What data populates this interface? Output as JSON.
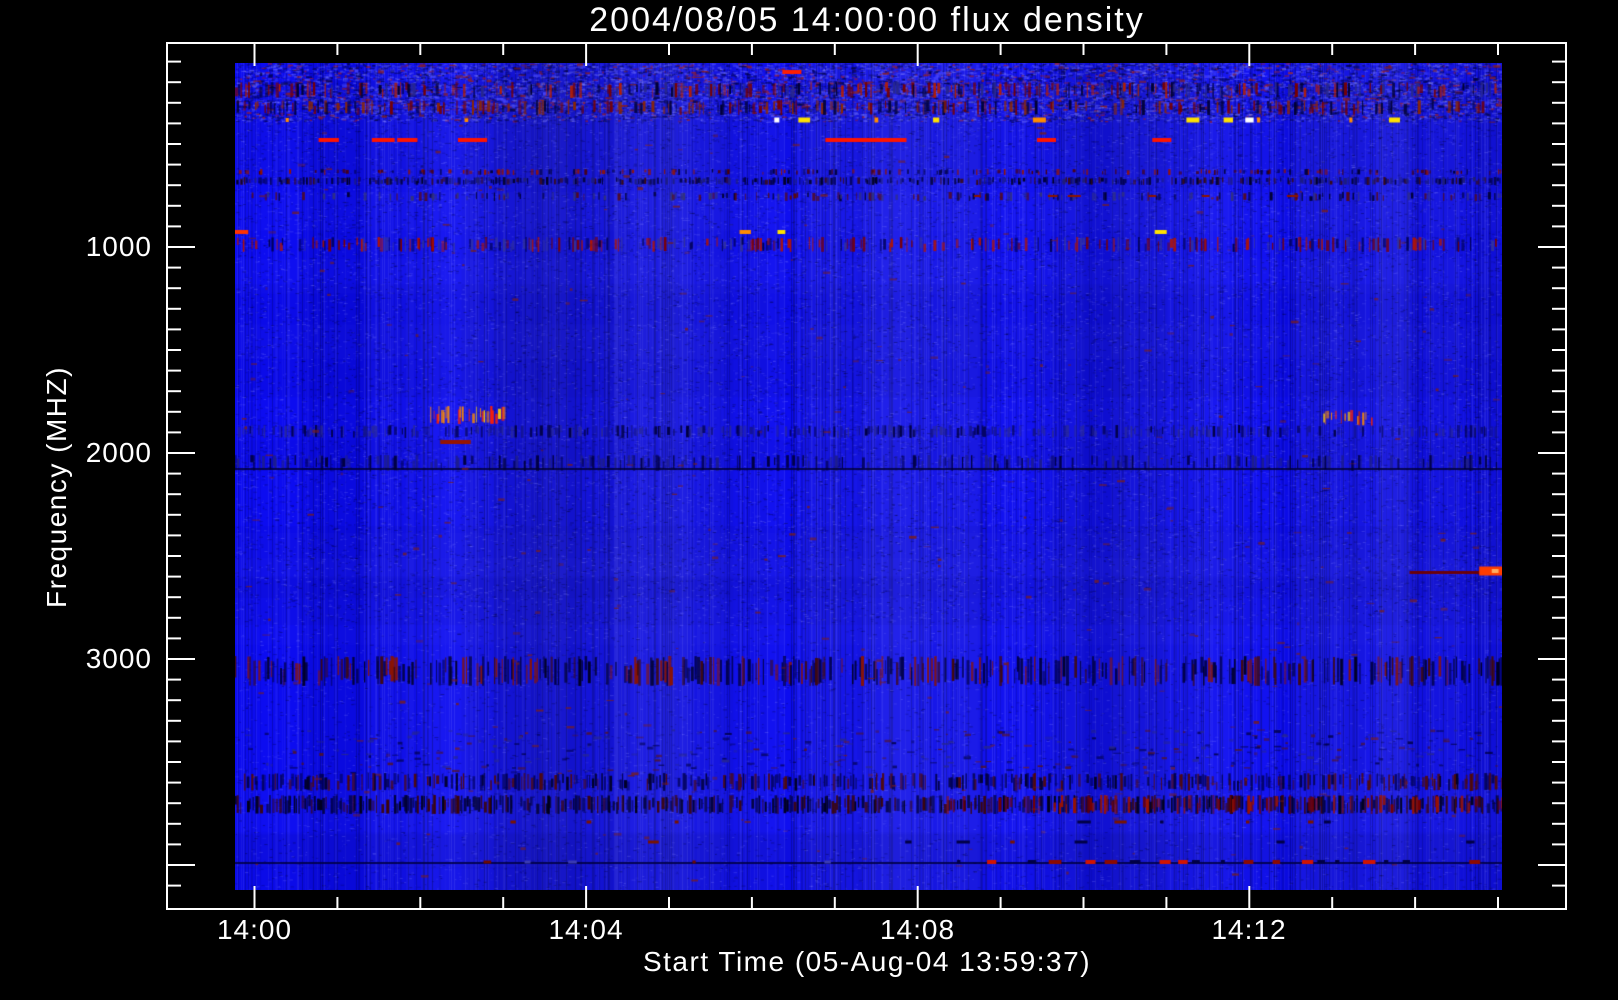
{
  "chart": {
    "background_color": "#000000",
    "frame_color": "#ffffff",
    "text_color": "#ffffff"
  },
  "chart_data": {
    "type": "heatmap",
    "title": "2004/08/05 14:00:00 flux density",
    "xlabel": "Start Time (05-Aug-04 13:59:37)",
    "ylabel": "Frequency (MHZ)",
    "x_ticks": [
      "14:00",
      "14:04",
      "14:08",
      "14:12"
    ],
    "x_minor_ticks_per_interval": 4,
    "y_tick_values": [
      1000,
      2000,
      3000
    ],
    "y_minor_step_mhz": 100,
    "freq_range_mhz": [
      100,
      4100
    ],
    "time_start": "13:59:37",
    "duration_minutes": 15.3,
    "legend_position": "none",
    "grid": false,
    "colormap": "saturated blue background; red/orange/yellow/white = strong flux (RFI), near-black = low",
    "base_color": "#0c0cf0",
    "features": [
      {
        "kind": "texture",
        "name": "top-noise-zone",
        "f0": 105,
        "f1": 330,
        "density": 1.3,
        "colors": [
          "#000046",
          "#4646ff",
          "#8c1e1e"
        ]
      },
      {
        "kind": "vticks",
        "name": "speckle-band-240mhz",
        "f0": 200,
        "f1": 275,
        "x0": 0,
        "x1": 1,
        "density": 0.55,
        "colors": [
          "#780000",
          "#000032",
          "#b41e00",
          "#28288c"
        ]
      },
      {
        "kind": "vticks",
        "name": "speckle-band-320mhz",
        "f0": 285,
        "f1": 360,
        "x0": 0,
        "x1": 1,
        "density": 0.4,
        "colors": [
          "#780000",
          "#000032",
          "#8c2800"
        ]
      },
      {
        "kind": "segments",
        "name": "red-dash-150mhz",
        "f": 150,
        "h": 4,
        "list": [
          [
            0.432,
            0.447,
            "#ff1e00"
          ]
        ]
      },
      {
        "kind": "dashrow",
        "name": "rfi-row-380mhz",
        "f": 383,
        "x0": 0.385,
        "x1": 1.0,
        "density": 0.3,
        "h": 5,
        "colors": [
          "#ff2000",
          "#ff8c00",
          "#ffffff",
          "#ffe100",
          "#b42000"
        ]
      },
      {
        "kind": "dashrow",
        "name": "rfi-row-380mhz-left",
        "f": 383,
        "x0": 0.04,
        "x1": 0.3,
        "density": 0.1,
        "h": 4,
        "colors": [
          "#b42000",
          "#ff8c00"
        ]
      },
      {
        "kind": "segments",
        "name": "red-lines-480mhz",
        "f": 480,
        "h": 4,
        "list": [
          [
            0.066,
            0.082,
            "#ff1400"
          ],
          [
            0.108,
            0.126,
            "#ff1400"
          ],
          [
            0.128,
            0.144,
            "#ff1400"
          ],
          [
            0.176,
            0.199,
            "#ff1400"
          ],
          [
            0.466,
            0.53,
            "#ff1400"
          ],
          [
            0.633,
            0.648,
            "#ff1400"
          ],
          [
            0.724,
            0.739,
            "#ff1400"
          ]
        ]
      },
      {
        "kind": "vticks",
        "name": "speckle-band-640mhz",
        "f0": 620,
        "f1": 652,
        "x0": 0,
        "x1": 1,
        "density": 0.35,
        "colors": [
          "#961400",
          "#500000",
          "#000032"
        ]
      },
      {
        "kind": "vticks",
        "name": "dark-band-680mhz",
        "f0": 660,
        "f1": 700,
        "x0": 0,
        "x1": 1,
        "density": 0.75,
        "colors": [
          "#000020",
          "#000046",
          "#1e1e78",
          "#3c0a0a"
        ]
      },
      {
        "kind": "vticks",
        "name": "dark-band-755mhz",
        "f0": 735,
        "f1": 775,
        "x0": 0,
        "x1": 1,
        "density": 0.35,
        "colors": [
          "#000032",
          "#32327d",
          "#5a0a0a"
        ]
      },
      {
        "kind": "dashrow",
        "name": "dim-red-row-750mhz",
        "f": 752,
        "x0": 0.45,
        "x1": 1.0,
        "density": 0.18,
        "h": 2,
        "colors": [
          "#8c1400"
        ]
      },
      {
        "kind": "dashrow",
        "name": "dot-row-925mhz",
        "f": 925,
        "x0": 0,
        "x1": 1,
        "density": 0.12,
        "h": 4,
        "colors": [
          "#ffffff",
          "#ff8c00",
          "#ff3200",
          "#ffe100"
        ]
      },
      {
        "kind": "vticks",
        "name": "rfi-band-950-1025mhz",
        "f0": 950,
        "f1": 1025,
        "x0": 0,
        "x1": 1,
        "density": 0.5,
        "colors": [
          "#7d0000",
          "#b41400",
          "#000050",
          "#32329b"
        ]
      },
      {
        "kind": "vticks",
        "name": "color-cluster-1800-left",
        "f0": 1770,
        "f1": 1860,
        "x0": 0.154,
        "x1": 0.212,
        "density": 0.8,
        "colors": [
          "#ffd200",
          "#ff8c00",
          "#ff2000"
        ]
      },
      {
        "kind": "vticks",
        "name": "color-cluster-1800-right",
        "f0": 1790,
        "f1": 1870,
        "x0": 0.859,
        "x1": 0.897,
        "density": 0.8,
        "colors": [
          "#ffd200",
          "#ff8c00",
          "#ff2000",
          "#c81e00"
        ]
      },
      {
        "kind": "segments",
        "name": "dim-red-1950mhz",
        "f": 1947,
        "h": 4,
        "list": [
          [
            0.162,
            0.186,
            "#961400"
          ]
        ]
      },
      {
        "kind": "vticks",
        "name": "dark-striped-1890mhz",
        "f0": 1864,
        "f1": 1925,
        "x0": 0,
        "x1": 1,
        "density": 0.6,
        "colors": [
          "#000041",
          "#14148c",
          "#28289b"
        ]
      },
      {
        "kind": "vticks",
        "name": "dark-striped-2050mhz",
        "f0": 2010,
        "f1": 2085,
        "x0": 0,
        "x1": 1,
        "density": 0.5,
        "colors": [
          "#000041",
          "#1e1e8c"
        ]
      },
      {
        "kind": "hline",
        "name": "dark-line-2075mhz",
        "f": 2075,
        "h": 2,
        "color": "#000032",
        "alpha": 0.8,
        "x0": 0,
        "x1": 1
      },
      {
        "kind": "hline",
        "name": "red-line-2570mhz",
        "f": 2572,
        "h": 3,
        "color": "#700000",
        "alpha": 0.95,
        "x0": 0.927,
        "x1": 0.99
      },
      {
        "kind": "blob",
        "name": "bright-blob-2570mhz",
        "f": 2572,
        "x0": 0.982,
        "x1": 1.0,
        "h": 9,
        "color": "#ff3c00"
      },
      {
        "kind": "vticks",
        "name": "dark-band-3000mhz",
        "f0": 2985,
        "f1": 3130,
        "x0": 0,
        "x1": 1,
        "density": 0.7,
        "colors": [
          "#000020",
          "#000046",
          "#410a0a",
          "#8c1400"
        ]
      },
      {
        "kind": "texture",
        "name": "texture-3450mhz",
        "f0": 3340,
        "f1": 3550,
        "density": 0.8,
        "colors": [
          "#000046",
          "#28288c",
          "#5a1414"
        ]
      },
      {
        "kind": "vticks",
        "name": "dark-band-3600mhz",
        "f0": 3555,
        "f1": 3640,
        "x0": 0,
        "x1": 1,
        "density": 0.65,
        "colors": [
          "#000028",
          "#000050",
          "#500a0a"
        ]
      },
      {
        "kind": "vticks",
        "name": "darkest-band-3700mhz",
        "f0": 3660,
        "f1": 3750,
        "x0": 0,
        "x1": 1,
        "density": 0.85,
        "colors": [
          "#000014",
          "#000032",
          "#3c0505"
        ]
      },
      {
        "kind": "vticks",
        "name": "red-mix-3700mhz-right",
        "f0": 3660,
        "f1": 3750,
        "x0": 0.55,
        "x1": 1,
        "density": 0.35,
        "colors": [
          "#a01400",
          "#780000"
        ]
      },
      {
        "kind": "dashrow",
        "name": "sparse-row-3790mhz",
        "f": 3790,
        "x0": 0.1,
        "x1": 1,
        "density": 0.12,
        "h": 3,
        "colors": [
          "#781400",
          "#000046"
        ]
      },
      {
        "kind": "dashrow",
        "name": "sparse-row-3890mhz",
        "f": 3890,
        "x0": 0.3,
        "x1": 1,
        "density": 0.12,
        "h": 3,
        "colors": [
          "#781400",
          "#000046"
        ]
      },
      {
        "kind": "hline",
        "name": "dark-line-3985mhz",
        "f": 3985,
        "h": 2,
        "color": "#000041",
        "alpha": 0.85,
        "x0": 0,
        "x1": 1
      },
      {
        "kind": "dashrow",
        "name": "red-row-3985mhz-left",
        "f": 3985,
        "x0": 0.12,
        "x1": 0.5,
        "density": 0.25,
        "h": 3,
        "colors": [
          "#6e0a00",
          "#3c3cb4"
        ]
      },
      {
        "kind": "dashrow",
        "name": "red-row-3985mhz-right",
        "f": 3985,
        "x0": 0.5,
        "x1": 1,
        "density": 0.55,
        "h": 4,
        "colors": [
          "#d21400",
          "#8c0a00",
          "#000046"
        ]
      },
      {
        "kind": "texture",
        "name": "sparse-red-specks",
        "f0": 340,
        "f1": 4100,
        "density": 0.05,
        "colors": [
          "#781e1e"
        ]
      }
    ]
  }
}
